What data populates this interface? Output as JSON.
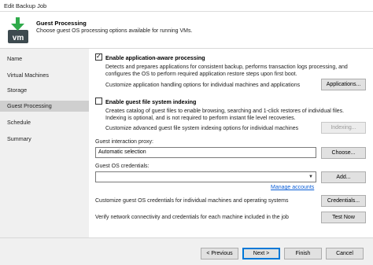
{
  "window": {
    "title": "Edit Backup Job"
  },
  "header": {
    "title": "Guest Processing",
    "subtitle": "Choose guest OS processing options available for running VMs.",
    "logo_text": "vm"
  },
  "sidebar": {
    "items": [
      {
        "label": "Name"
      },
      {
        "label": "Virtual Machines"
      },
      {
        "label": "Storage"
      },
      {
        "label": "Guest Processing"
      },
      {
        "label": "Schedule"
      },
      {
        "label": "Summary"
      }
    ],
    "active_index": 3
  },
  "app_aware": {
    "label": "Enable application-aware processing",
    "checked": true,
    "description_1": "Detects and prepares applications for consistent backup, performs transaction logs processing, and",
    "description_2": "configures the OS to perform required application restore steps upon first boot.",
    "customize_text": "Customize application handling options for individual machines and applications",
    "button_label": "Applications..."
  },
  "guest_index": {
    "label": "Enable guest file system indexing",
    "checked": false,
    "description_1": "Creates catalog of guest files to enable browsing, searching and 1-click restores of individual files.",
    "description_2": "Indexing is optional, and is not required to perform instant file level recoveries.",
    "customize_text": "Customize advanced guest file system indexing options for individual machines",
    "button_label": "Indexing..."
  },
  "proxy": {
    "label": "Guest interaction proxy:",
    "value": "Automatic selection",
    "button_label": "Choose..."
  },
  "credentials": {
    "label": "Guest OS credentials:",
    "value": "",
    "add_label": "Add...",
    "manage_link": "Manage accounts",
    "customize_text": "Customize guest OS credentials for individual machines and operating systems",
    "button_label": "Credentials...",
    "verify_text": "Verify network connectivity and credentials for each machine included in the job",
    "test_label": "Test Now"
  },
  "footer": {
    "previous": "< Previous",
    "next": "Next >",
    "finish": "Finish",
    "cancel": "Cancel"
  },
  "colors": {
    "logo_green": "#2faa4a",
    "logo_dark": "#3d4a4f",
    "link": "#0b5ed7",
    "active_nav": "#cfcfcf"
  }
}
